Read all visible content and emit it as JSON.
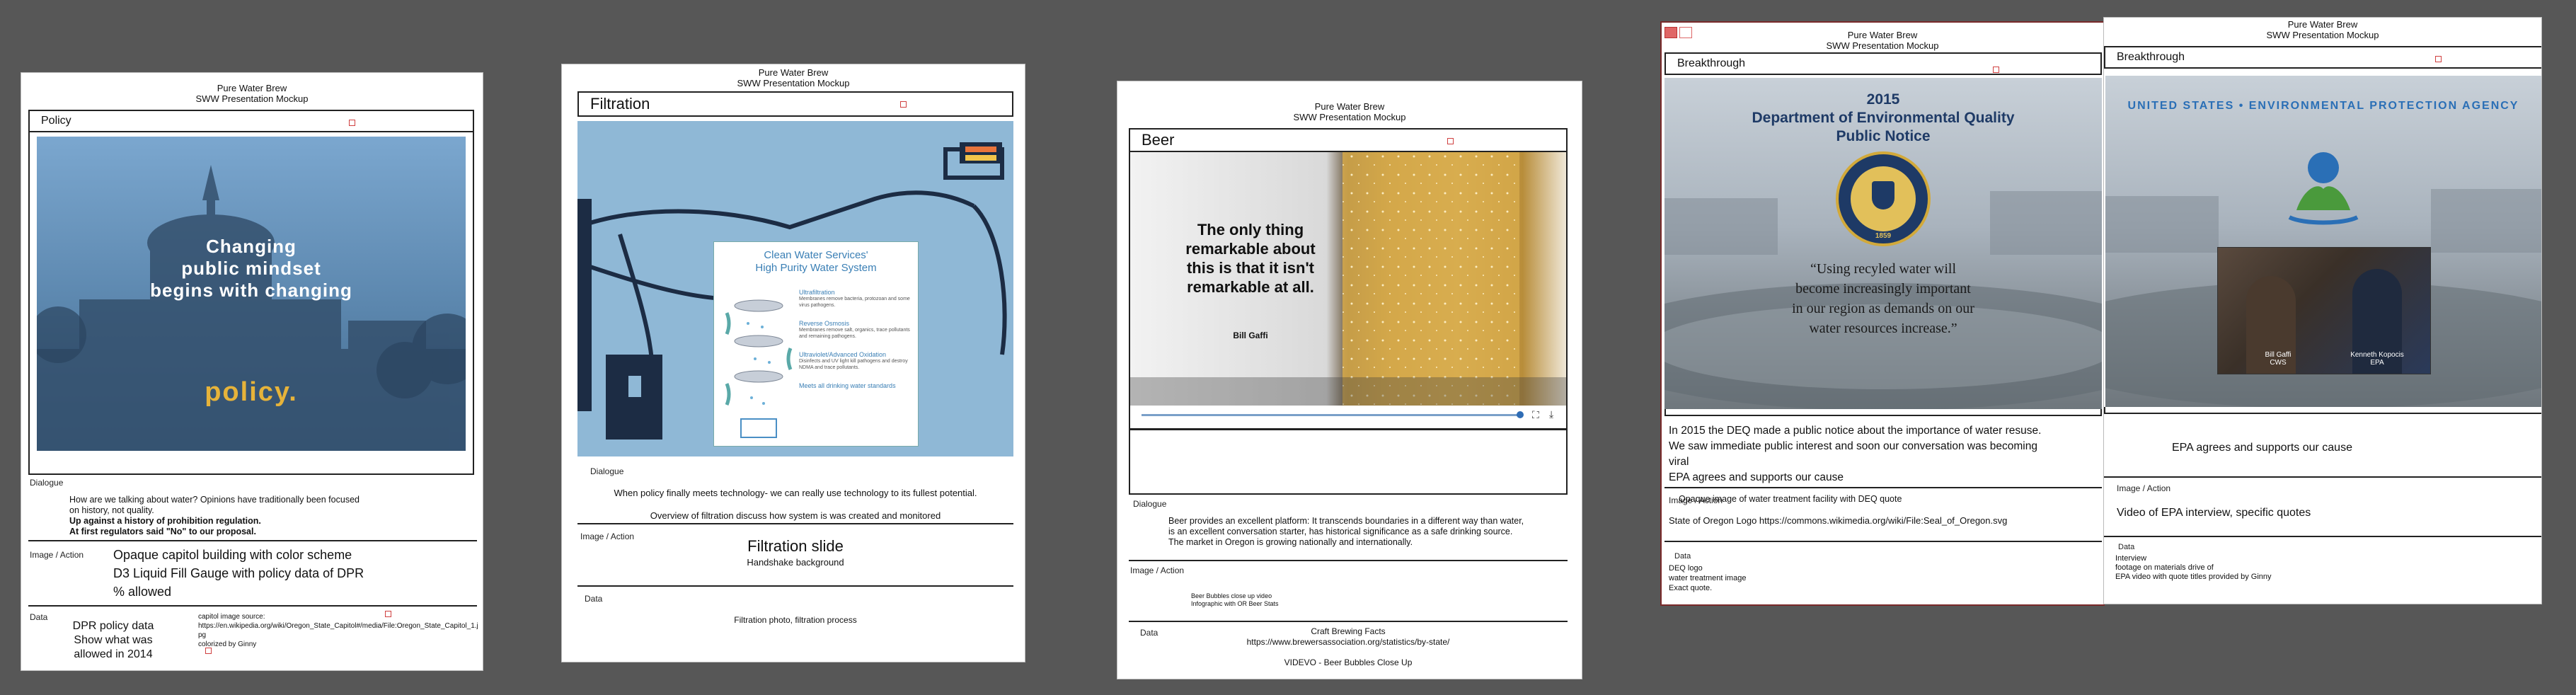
{
  "deck": {
    "header_line1": "Pure Water Brew",
    "header_line2": "SWW Presentation Mockup"
  },
  "slides": [
    {
      "title": "Policy",
      "slide_text_lines": [
        "Changing",
        "public mindset",
        "begins with changing"
      ],
      "slide_highlight": "policy.",
      "dialogue_label": "Dialogue",
      "dialogue_lines": [
        "How are we talking about water? Opinions have traditionally been focused",
        "on history, not quality.",
        "Up against a history of prohibition regulation.",
        "At first regulators said \"No\" to our proposal."
      ],
      "image_label": "Image / Action",
      "image_lines": [
        "Opaque capitol building with color scheme",
        "D3 Liquid Fill Gauge with policy data of  DPR",
        "% allowed"
      ],
      "data_label": "Data",
      "data_lines": [
        "DPR policy data",
        "Show what was",
        "allowed in 2014"
      ],
      "source_lines": [
        "capitol image source:",
        "https://en.wikipedia.org/wiki/Oregon_State_Capitol#/media/File:Oregon_State_Capitol_1.jpg",
        "colorized by Ginny"
      ]
    },
    {
      "title": "Filtration",
      "panel_title_line1": "Clean Water Services'",
      "panel_title_line2": "High Purity Water System",
      "steps": [
        {
          "name": "Ultrafiltration",
          "desc": "Membranes remove bacteria, protozoan and some virus pathogens."
        },
        {
          "name": "Reverse Osmosis",
          "desc": "Membranes remove salt, organics, trace pollutants and remaining pathogens."
        },
        {
          "name": "Ultraviolet/Advanced Oxidation",
          "desc": "Disinfects and UV light kill pathogens and destroy NDMA and trace pollutants."
        },
        {
          "name": "Meets all drinking water standards",
          "desc": ""
        }
      ],
      "dialogue_label": "Dialogue",
      "dialogue_line1": "When policy finally meets technology- we can really use technology to its fullest potential.",
      "dialogue_line2": "Overview of filtration discuss how system is was created and monitored",
      "image_label": "Image / Action",
      "image_title": "Filtration slide",
      "image_sub": "Handshake background",
      "data_label": "Data",
      "data_text": "Filtration photo, filtration process"
    },
    {
      "title": "Beer",
      "quote": "The only thing remarkable about this is that it isn't remarkable at all.",
      "quote_author": "Bill Gaffi",
      "dialogue_label": "Dialogue",
      "dialogue_lines": [
        "Beer provides an excellent platform: It transcends boundaries in a different way than water,",
        "is an excellent conversation starter, has historical significance as a safe drinking source.",
        "The market in Oregon is growing nationally and internationally."
      ],
      "image_label": "Image / Action",
      "image_lines": [
        "Beer Bubbles close up video",
        "Infographic with OR Beer Stats"
      ],
      "data_label": "Data",
      "data_lines": [
        "Craft Brewing Facts",
        "https://www.brewersassociation.org/statistics/by-state/"
      ],
      "video_credit": "VIDEVO - Beer Bubbles Close Up"
    },
    {
      "title": "Breakthrough",
      "slide_year": "2015",
      "slide_heading_line1": "Department of Environmental Quality",
      "slide_heading_line2": "Public Notice",
      "seal_year": "1859",
      "quote_lines": [
        "“Using recyled water will",
        "become increasingly important",
        "in our region as demands on our",
        "water resources increase.”"
      ],
      "dialogue_lines": [
        "In 2015 the DEQ made a public notice about the importance of water resuse.",
        "We saw immediate public interest and soon our conversation was becoming",
        "viral",
        "EPA agrees and supports our cause"
      ],
      "image_label": "Image / Action",
      "image_text": "Opaque image of water treatment facility with DEQ quote",
      "image_source": "State of Oregon Logo https://commons.wikimedia.org/wiki/File:Seal_of_Oregon.svg",
      "data_label": "Data",
      "data_lines": [
        "DEQ logo",
        "water treatment image",
        "Exact quote."
      ]
    },
    {
      "title": "Breakthrough",
      "epa_ring_text": "UNITED STATES • ENVIRONMENTAL PROTECTION AGENCY",
      "person1_name": "Bill Gaffi",
      "person1_org": "CWS",
      "person2_name": "Kenneth Kopocis",
      "person2_org": "EPA",
      "dialogue_text": "EPA agrees and supports our cause",
      "image_label": "Image / Action",
      "image_text": "Video of EPA interview,  specific quotes",
      "data_label": "Data",
      "data_lines": [
        "Interview",
        "footage on materials drive of",
        "EPA video with quote titles provided by Ginny"
      ]
    }
  ],
  "colors": {
    "background": "#575757",
    "policy_slide_blue": "#3d5f80",
    "policy_gold": "#e6b33a",
    "filtration_bg": "#8fb8d6",
    "epa_blue": "#2a6fb6",
    "epa_green": "#4a9a3c"
  }
}
